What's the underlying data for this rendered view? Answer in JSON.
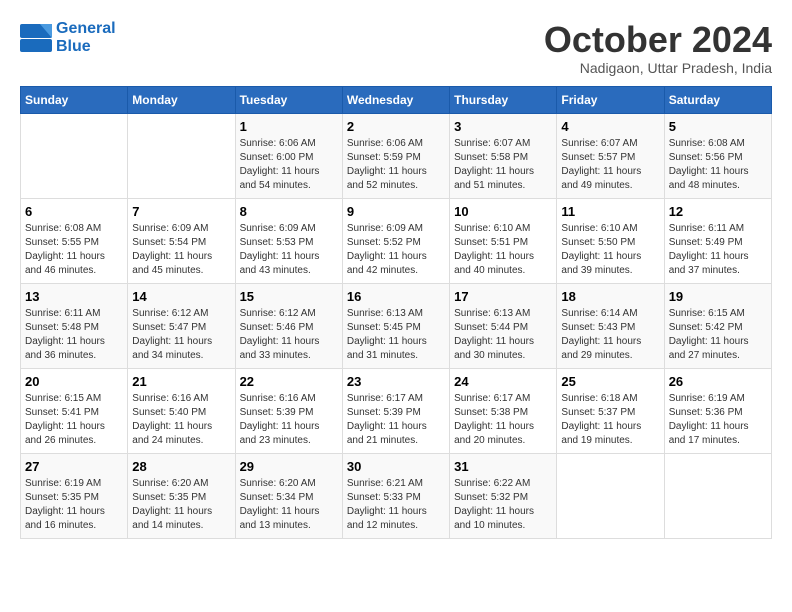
{
  "header": {
    "logo_line1": "General",
    "logo_line2": "Blue",
    "month": "October 2024",
    "location": "Nadigaon, Uttar Pradesh, India"
  },
  "days_of_week": [
    "Sunday",
    "Monday",
    "Tuesday",
    "Wednesday",
    "Thursday",
    "Friday",
    "Saturday"
  ],
  "weeks": [
    [
      {
        "day": "",
        "content": ""
      },
      {
        "day": "",
        "content": ""
      },
      {
        "day": "1",
        "content": "Sunrise: 6:06 AM\nSunset: 6:00 PM\nDaylight: 11 hours and 54 minutes."
      },
      {
        "day": "2",
        "content": "Sunrise: 6:06 AM\nSunset: 5:59 PM\nDaylight: 11 hours and 52 minutes."
      },
      {
        "day": "3",
        "content": "Sunrise: 6:07 AM\nSunset: 5:58 PM\nDaylight: 11 hours and 51 minutes."
      },
      {
        "day": "4",
        "content": "Sunrise: 6:07 AM\nSunset: 5:57 PM\nDaylight: 11 hours and 49 minutes."
      },
      {
        "day": "5",
        "content": "Sunrise: 6:08 AM\nSunset: 5:56 PM\nDaylight: 11 hours and 48 minutes."
      }
    ],
    [
      {
        "day": "6",
        "content": "Sunrise: 6:08 AM\nSunset: 5:55 PM\nDaylight: 11 hours and 46 minutes."
      },
      {
        "day": "7",
        "content": "Sunrise: 6:09 AM\nSunset: 5:54 PM\nDaylight: 11 hours and 45 minutes."
      },
      {
        "day": "8",
        "content": "Sunrise: 6:09 AM\nSunset: 5:53 PM\nDaylight: 11 hours and 43 minutes."
      },
      {
        "day": "9",
        "content": "Sunrise: 6:09 AM\nSunset: 5:52 PM\nDaylight: 11 hours and 42 minutes."
      },
      {
        "day": "10",
        "content": "Sunrise: 6:10 AM\nSunset: 5:51 PM\nDaylight: 11 hours and 40 minutes."
      },
      {
        "day": "11",
        "content": "Sunrise: 6:10 AM\nSunset: 5:50 PM\nDaylight: 11 hours and 39 minutes."
      },
      {
        "day": "12",
        "content": "Sunrise: 6:11 AM\nSunset: 5:49 PM\nDaylight: 11 hours and 37 minutes."
      }
    ],
    [
      {
        "day": "13",
        "content": "Sunrise: 6:11 AM\nSunset: 5:48 PM\nDaylight: 11 hours and 36 minutes."
      },
      {
        "day": "14",
        "content": "Sunrise: 6:12 AM\nSunset: 5:47 PM\nDaylight: 11 hours and 34 minutes."
      },
      {
        "day": "15",
        "content": "Sunrise: 6:12 AM\nSunset: 5:46 PM\nDaylight: 11 hours and 33 minutes."
      },
      {
        "day": "16",
        "content": "Sunrise: 6:13 AM\nSunset: 5:45 PM\nDaylight: 11 hours and 31 minutes."
      },
      {
        "day": "17",
        "content": "Sunrise: 6:13 AM\nSunset: 5:44 PM\nDaylight: 11 hours and 30 minutes."
      },
      {
        "day": "18",
        "content": "Sunrise: 6:14 AM\nSunset: 5:43 PM\nDaylight: 11 hours and 29 minutes."
      },
      {
        "day": "19",
        "content": "Sunrise: 6:15 AM\nSunset: 5:42 PM\nDaylight: 11 hours and 27 minutes."
      }
    ],
    [
      {
        "day": "20",
        "content": "Sunrise: 6:15 AM\nSunset: 5:41 PM\nDaylight: 11 hours and 26 minutes."
      },
      {
        "day": "21",
        "content": "Sunrise: 6:16 AM\nSunset: 5:40 PM\nDaylight: 11 hours and 24 minutes."
      },
      {
        "day": "22",
        "content": "Sunrise: 6:16 AM\nSunset: 5:39 PM\nDaylight: 11 hours and 23 minutes."
      },
      {
        "day": "23",
        "content": "Sunrise: 6:17 AM\nSunset: 5:39 PM\nDaylight: 11 hours and 21 minutes."
      },
      {
        "day": "24",
        "content": "Sunrise: 6:17 AM\nSunset: 5:38 PM\nDaylight: 11 hours and 20 minutes."
      },
      {
        "day": "25",
        "content": "Sunrise: 6:18 AM\nSunset: 5:37 PM\nDaylight: 11 hours and 19 minutes."
      },
      {
        "day": "26",
        "content": "Sunrise: 6:19 AM\nSunset: 5:36 PM\nDaylight: 11 hours and 17 minutes."
      }
    ],
    [
      {
        "day": "27",
        "content": "Sunrise: 6:19 AM\nSunset: 5:35 PM\nDaylight: 11 hours and 16 minutes."
      },
      {
        "day": "28",
        "content": "Sunrise: 6:20 AM\nSunset: 5:35 PM\nDaylight: 11 hours and 14 minutes."
      },
      {
        "day": "29",
        "content": "Sunrise: 6:20 AM\nSunset: 5:34 PM\nDaylight: 11 hours and 13 minutes."
      },
      {
        "day": "30",
        "content": "Sunrise: 6:21 AM\nSunset: 5:33 PM\nDaylight: 11 hours and 12 minutes."
      },
      {
        "day": "31",
        "content": "Sunrise: 6:22 AM\nSunset: 5:32 PM\nDaylight: 11 hours and 10 minutes."
      },
      {
        "day": "",
        "content": ""
      },
      {
        "day": "",
        "content": ""
      }
    ]
  ]
}
